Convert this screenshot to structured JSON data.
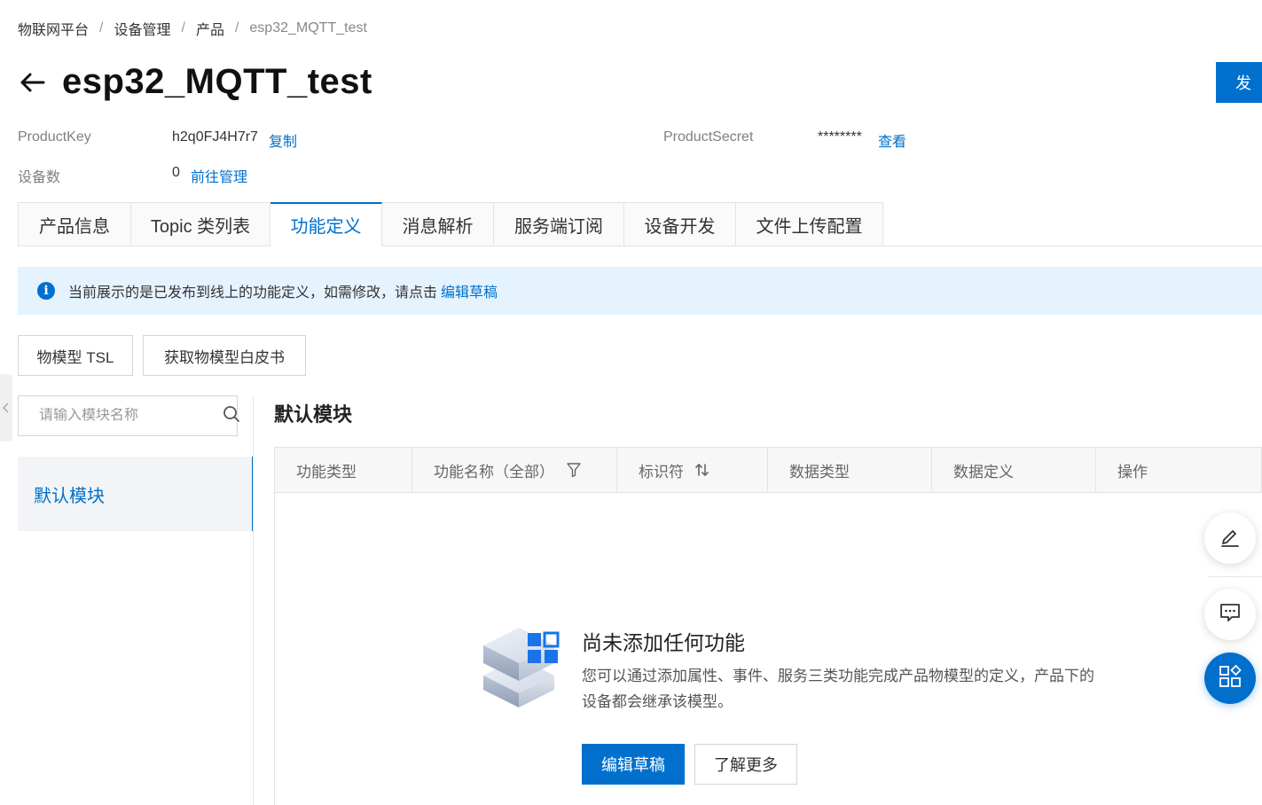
{
  "breadcrumb": {
    "items": [
      "物联网平台",
      "设备管理",
      "产品"
    ],
    "current": "esp32_MQTT_test",
    "separator": "/"
  },
  "header": {
    "title": "esp32_MQTT_test",
    "publish_label": "发"
  },
  "product_info": {
    "product_key_label": "ProductKey",
    "product_key_value": "h2q0FJ4H7r7",
    "copy_label": "复制",
    "product_secret_label": "ProductSecret",
    "product_secret_value": "********",
    "view_label": "查看",
    "device_count_label": "设备数",
    "device_count_value": "0",
    "manage_label": "前往管理"
  },
  "tabs": [
    {
      "label": "产品信息",
      "active": false
    },
    {
      "label": "Topic 类列表",
      "active": false
    },
    {
      "label": "功能定义",
      "active": true
    },
    {
      "label": "消息解析",
      "active": false
    },
    {
      "label": "服务端订阅",
      "active": false
    },
    {
      "label": "设备开发",
      "active": false
    },
    {
      "label": "文件上传配置",
      "active": false
    }
  ],
  "notice": {
    "text": "当前展示的是已发布到线上的功能定义，如需修改，请点击",
    "link": "编辑草稿"
  },
  "toolbar": {
    "tsl_label": "物模型 TSL",
    "whitepaper_label": "获取物模型白皮书"
  },
  "sidebar": {
    "search_placeholder": "请输入模块名称",
    "modules": [
      "默认模块"
    ]
  },
  "main": {
    "section_title": "默认模块",
    "columns": [
      "功能类型",
      "功能名称（全部）",
      "标识符",
      "数据类型",
      "数据定义",
      "操作"
    ]
  },
  "empty": {
    "title": "尚未添加任何功能",
    "desc": "您可以通过添加属性、事件、服务三类功能完成产品物模型的定义，产品下的设备都会继承该模型。",
    "edit_label": "编辑草稿",
    "learn_label": "了解更多"
  },
  "colors": {
    "primary": "#0070cc",
    "notice_bg": "#e5f3ff",
    "tab_bg": "#fafafa",
    "border": "#e3e3e3"
  },
  "icons": [
    "back-arrow-icon",
    "info-icon",
    "search-icon",
    "filter-icon",
    "sort-icon",
    "edit-icon",
    "chat-icon",
    "apps-icon",
    "cube-illustration"
  ]
}
